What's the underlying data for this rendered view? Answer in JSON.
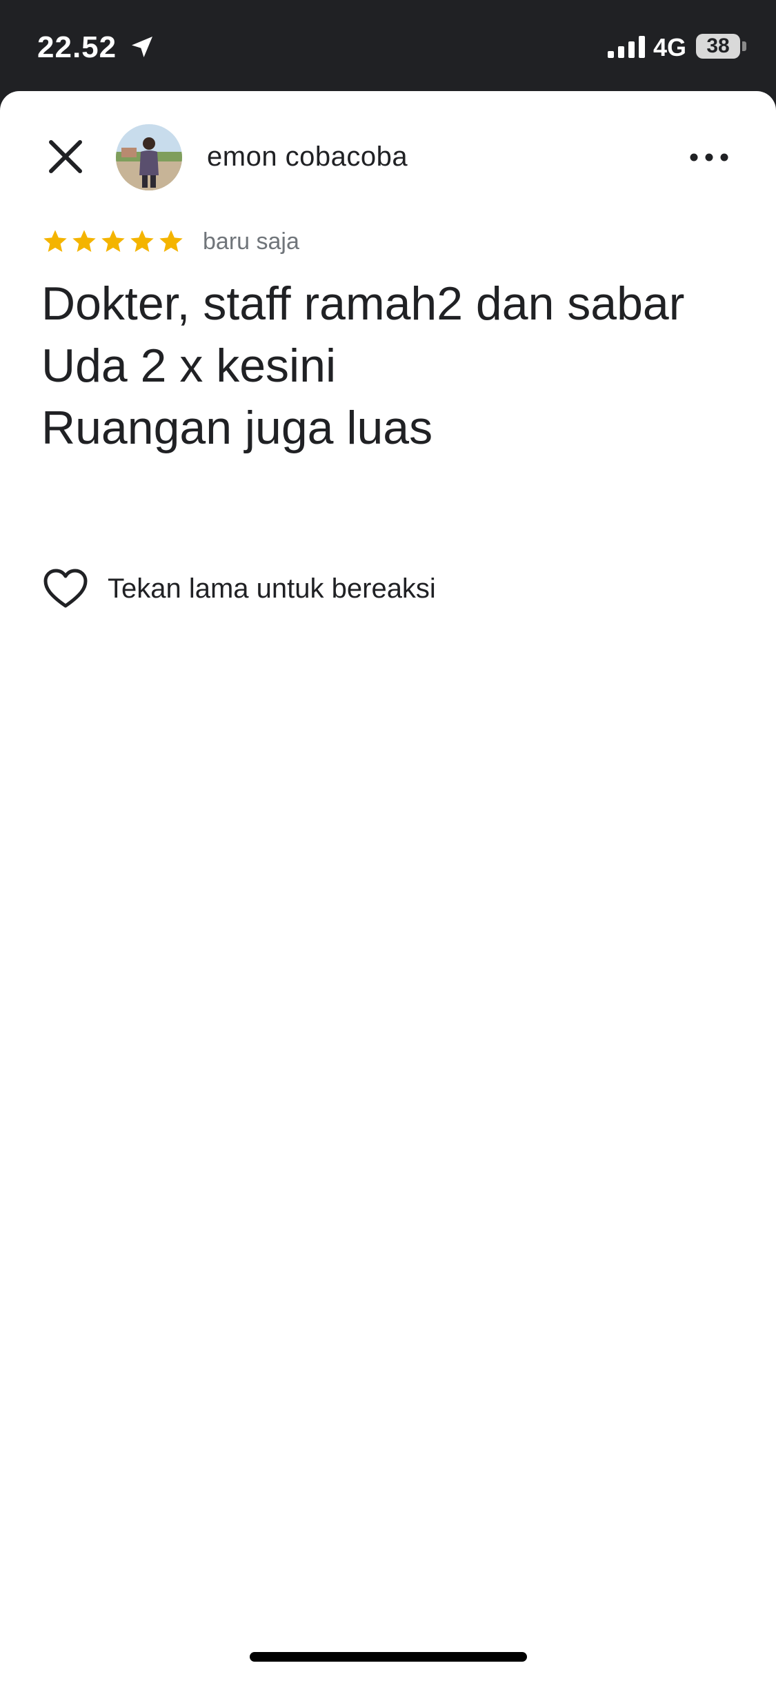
{
  "status_bar": {
    "time": "22.52",
    "network": "4G",
    "battery": "38"
  },
  "review": {
    "author": "emon cobacoba",
    "rating": 5,
    "timestamp": "baru saja",
    "text": "Dokter, staff ramah2 dan sabar\nUda 2 x kesini\nRuangan juga luas",
    "react_hint": "Tekan lama untuk bereaksi"
  },
  "colors": {
    "star": "#f4b400",
    "status_bar_bg": "#202124",
    "text_primary": "#202124",
    "text_secondary": "#70757a"
  }
}
